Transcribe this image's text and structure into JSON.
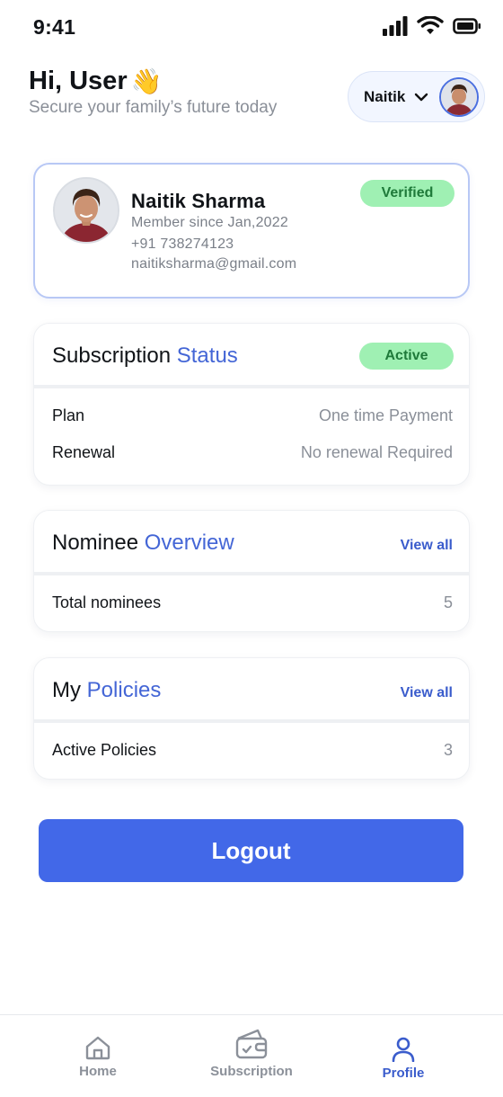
{
  "status_bar": {
    "time": "9:41"
  },
  "header": {
    "greeting": "Hi, User",
    "wave_emoji": "👋",
    "subtitle": "Secure your family’s future today",
    "user_chip": {
      "name": "Naitik"
    }
  },
  "profile": {
    "name": "Naitik Sharma",
    "member_since": "Member since Jan,2022",
    "phone": "+91 738274123",
    "email": "naitiksharma@gmail.com",
    "badge": "Verified"
  },
  "subscription": {
    "title": "Subscription",
    "title_accent": "Status",
    "badge": "Active",
    "rows": [
      {
        "label": "Plan",
        "value": "One time Payment"
      },
      {
        "label": "Renewal",
        "value": "No renewal Required"
      }
    ]
  },
  "nominee": {
    "title": "Nominee",
    "title_accent": "Overview",
    "view_all": "View all",
    "row": {
      "label": "Total nominees",
      "value": "5"
    }
  },
  "policies": {
    "title": "My",
    "title_accent": "Policies",
    "view_all": "View all",
    "row": {
      "label": "Active Policies",
      "value": "3"
    }
  },
  "logout_label": "Logout",
  "bottom_nav": {
    "items": [
      {
        "label": "Home",
        "icon": "home-icon"
      },
      {
        "label": "Subscription",
        "icon": "wallet-icon"
      },
      {
        "label": "Profile",
        "icon": "user-icon",
        "active": true
      }
    ]
  },
  "colors": {
    "accent": "#4466d6",
    "button": "#4268e8",
    "badge_bg": "#9ff0b3",
    "badge_text": "#1f7a3a"
  }
}
